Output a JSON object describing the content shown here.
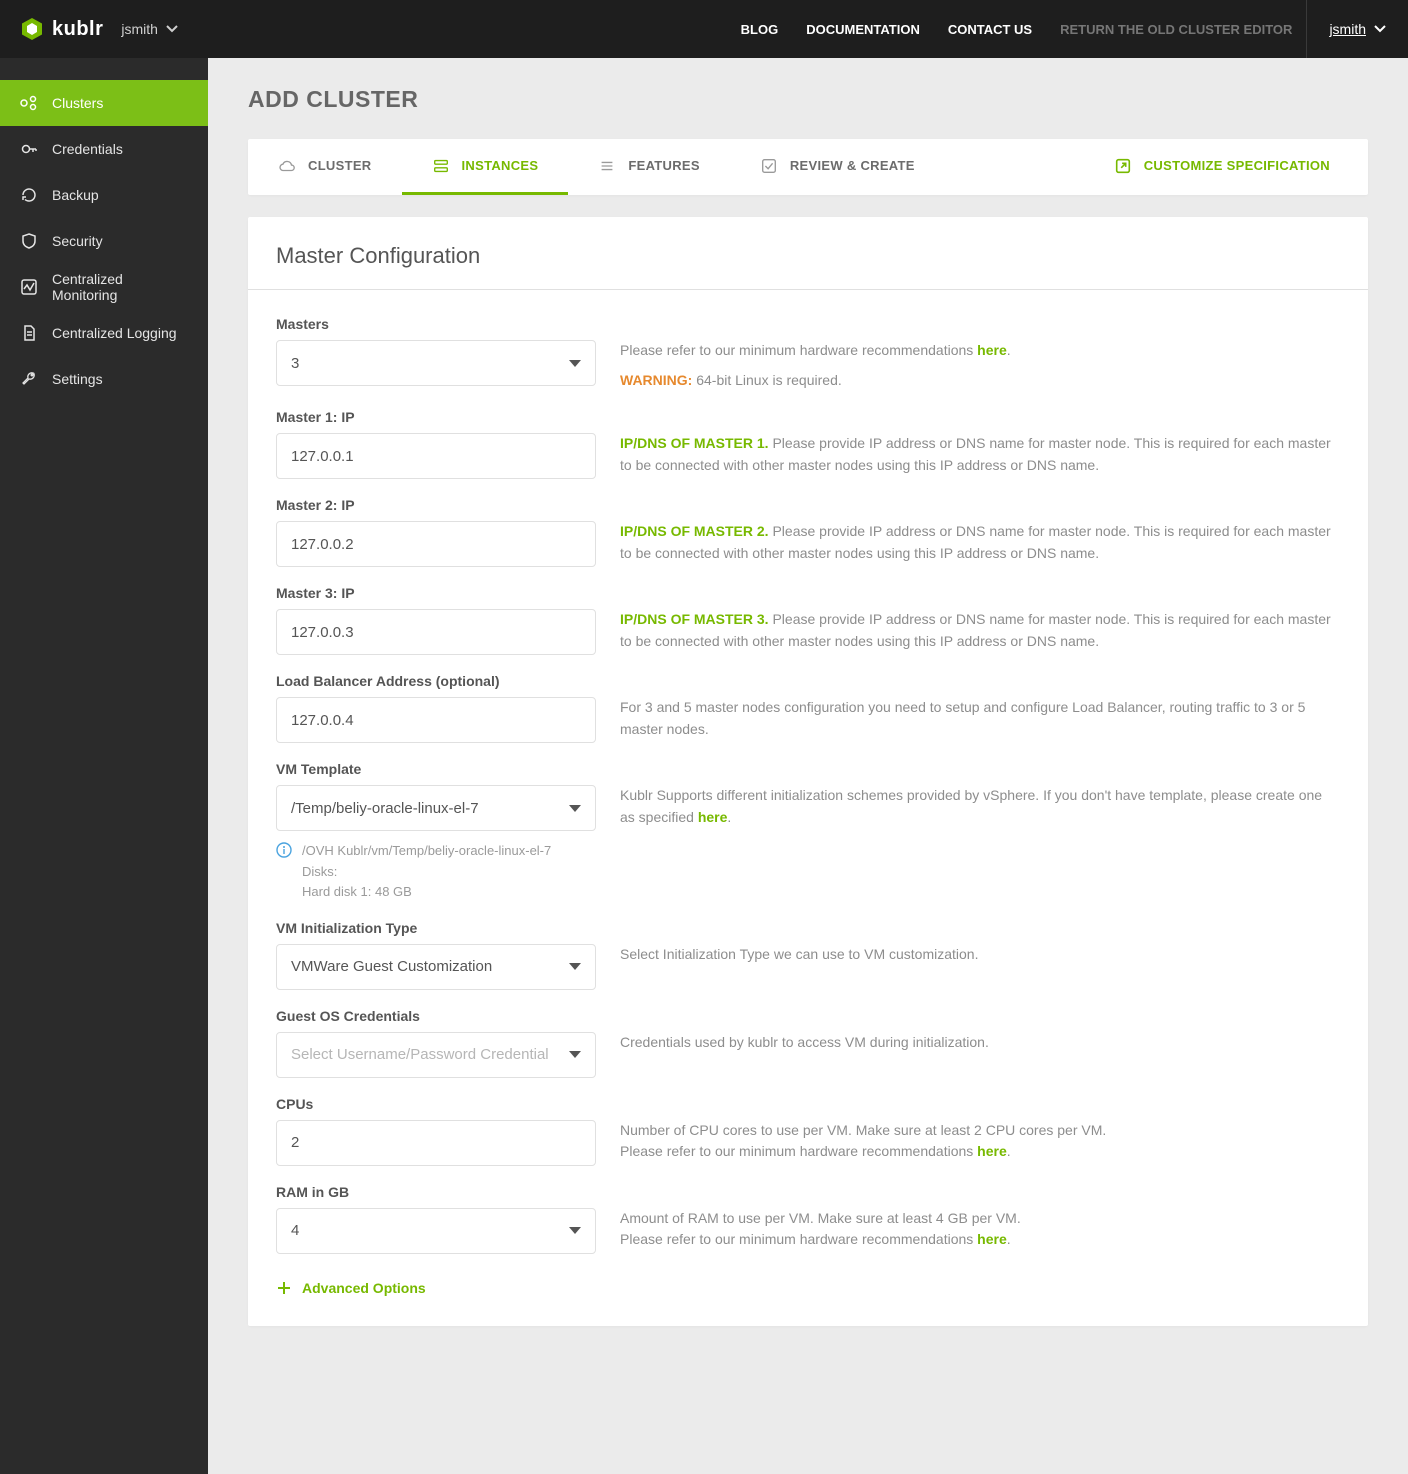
{
  "brand": {
    "name": "kublr"
  },
  "top_user_left": "jsmith",
  "top_nav": {
    "blog": "BLOG",
    "docs": "DOCUMENTATION",
    "contact": "CONTACT US",
    "old_editor": "RETURN THE OLD CLUSTER EDITOR"
  },
  "top_user_right": "jsmith",
  "sidebar": {
    "items": [
      {
        "label": "Clusters"
      },
      {
        "label": "Credentials"
      },
      {
        "label": "Backup"
      },
      {
        "label": "Security"
      },
      {
        "label": "Centralized Monitoring"
      },
      {
        "label": "Centralized Logging"
      },
      {
        "label": "Settings"
      }
    ]
  },
  "page": {
    "title": "ADD CLUSTER"
  },
  "tabs": {
    "cluster": "CLUSTER",
    "instances": "INSTANCES",
    "features": "FEATURES",
    "review": "REVIEW & CREATE",
    "customize": "CUSTOMIZE SPECIFICATION"
  },
  "section": {
    "title": "Master Configuration",
    "masters": {
      "label": "Masters",
      "value": "3",
      "help_prefix": "Please refer to our minimum hardware recommendations ",
      "help_link": "here",
      "help_suffix": ".",
      "warn_label": "WARNING:",
      "warn_text": " 64-bit Linux is required."
    },
    "master1": {
      "label": "Master 1: IP",
      "value": "127.0.0.1",
      "h_prefix": "IP/DNS OF MASTER 1.",
      "h_text": " Please provide IP address or DNS name for master node. This is required for each master to be connected with other master nodes using this IP address or DNS name."
    },
    "master2": {
      "label": "Master 2: IP",
      "value": "127.0.0.2",
      "h_prefix": "IP/DNS OF MASTER 2.",
      "h_text": " Please provide IP address or DNS name for master node. This is required for each master to be connected with other master nodes using this IP address or DNS name."
    },
    "master3": {
      "label": "Master 3: IP",
      "value": "127.0.0.3",
      "h_prefix": "IP/DNS OF MASTER 3.",
      "h_text": " Please provide IP address or DNS name for master node. This is required for each master to be connected with other master nodes using this IP address or DNS name."
    },
    "lb": {
      "label": "Load Balancer Address (optional)",
      "value": "127.0.0.4",
      "help": "For 3 and 5 master nodes configuration you need to setup and configure Load Balancer, routing traffic to 3 or 5 master nodes."
    },
    "vmtpl": {
      "label": "VM Template",
      "value": "/Temp/beliy-oracle-linux-el-7",
      "info_path": "/OVH Kublr/vm/Temp/beliy-oracle-linux-el-7",
      "info_disks_label": "Disks:",
      "info_disk1": "Hard disk 1: 48 GB",
      "help_prefix": "Kublr Supports different initialization schemes provided by vSphere. If you don't have template, please create one as specified ",
      "help_link": "here",
      "help_suffix": "."
    },
    "vminit": {
      "label": "VM Initialization Type",
      "value": "VMWare Guest Customization",
      "help": "Select Initialization Type we can use to VM customization."
    },
    "guest": {
      "label": "Guest OS Credentials",
      "placeholder": "Select Username/Password Credential",
      "help": "Credentials used by kublr to access VM during initialization."
    },
    "cpus": {
      "label": "CPUs",
      "value": "2",
      "help_line1": "Number of CPU cores to use per VM. Make sure at least 2 CPU cores per VM.",
      "help_line2_prefix": "Please refer to our minimum hardware recommendations ",
      "help_link": "here",
      "help_suffix": "."
    },
    "ram": {
      "label": "RAM in GB",
      "value": "4",
      "help_line1": "Amount of RAM to use per VM. Make sure at least 4 GB per VM.",
      "help_line2_prefix": "Please refer to our minimum hardware recommendations ",
      "help_link": "here",
      "help_suffix": "."
    },
    "advanced": "Advanced Options"
  }
}
